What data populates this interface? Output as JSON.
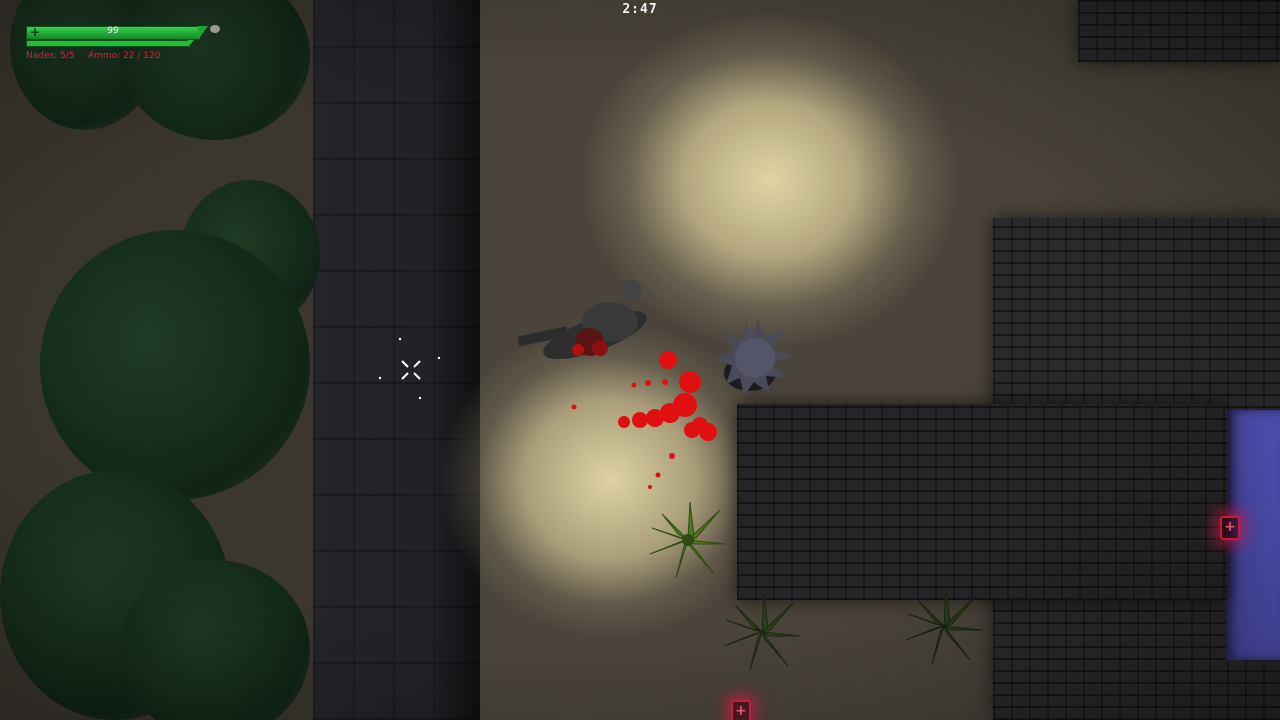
{
  "hud": {
    "health_value": "99",
    "health_fraction": 0.99,
    "nades_label": "Nades: 5/5",
    "ammo_label": "Ammo: 22 / 120"
  },
  "timer": "2:47",
  "colors": {
    "health_green": "#1ea635",
    "hud_red": "#e0202a",
    "blood": "#e01010",
    "medkit_glow": "#ff1450",
    "room_light": "#5858c8"
  },
  "icons": {
    "health": "plus-icon",
    "grenade": "grenade-icon",
    "medkit": "medkit-icon",
    "crosshair": "crosshair-icon"
  }
}
